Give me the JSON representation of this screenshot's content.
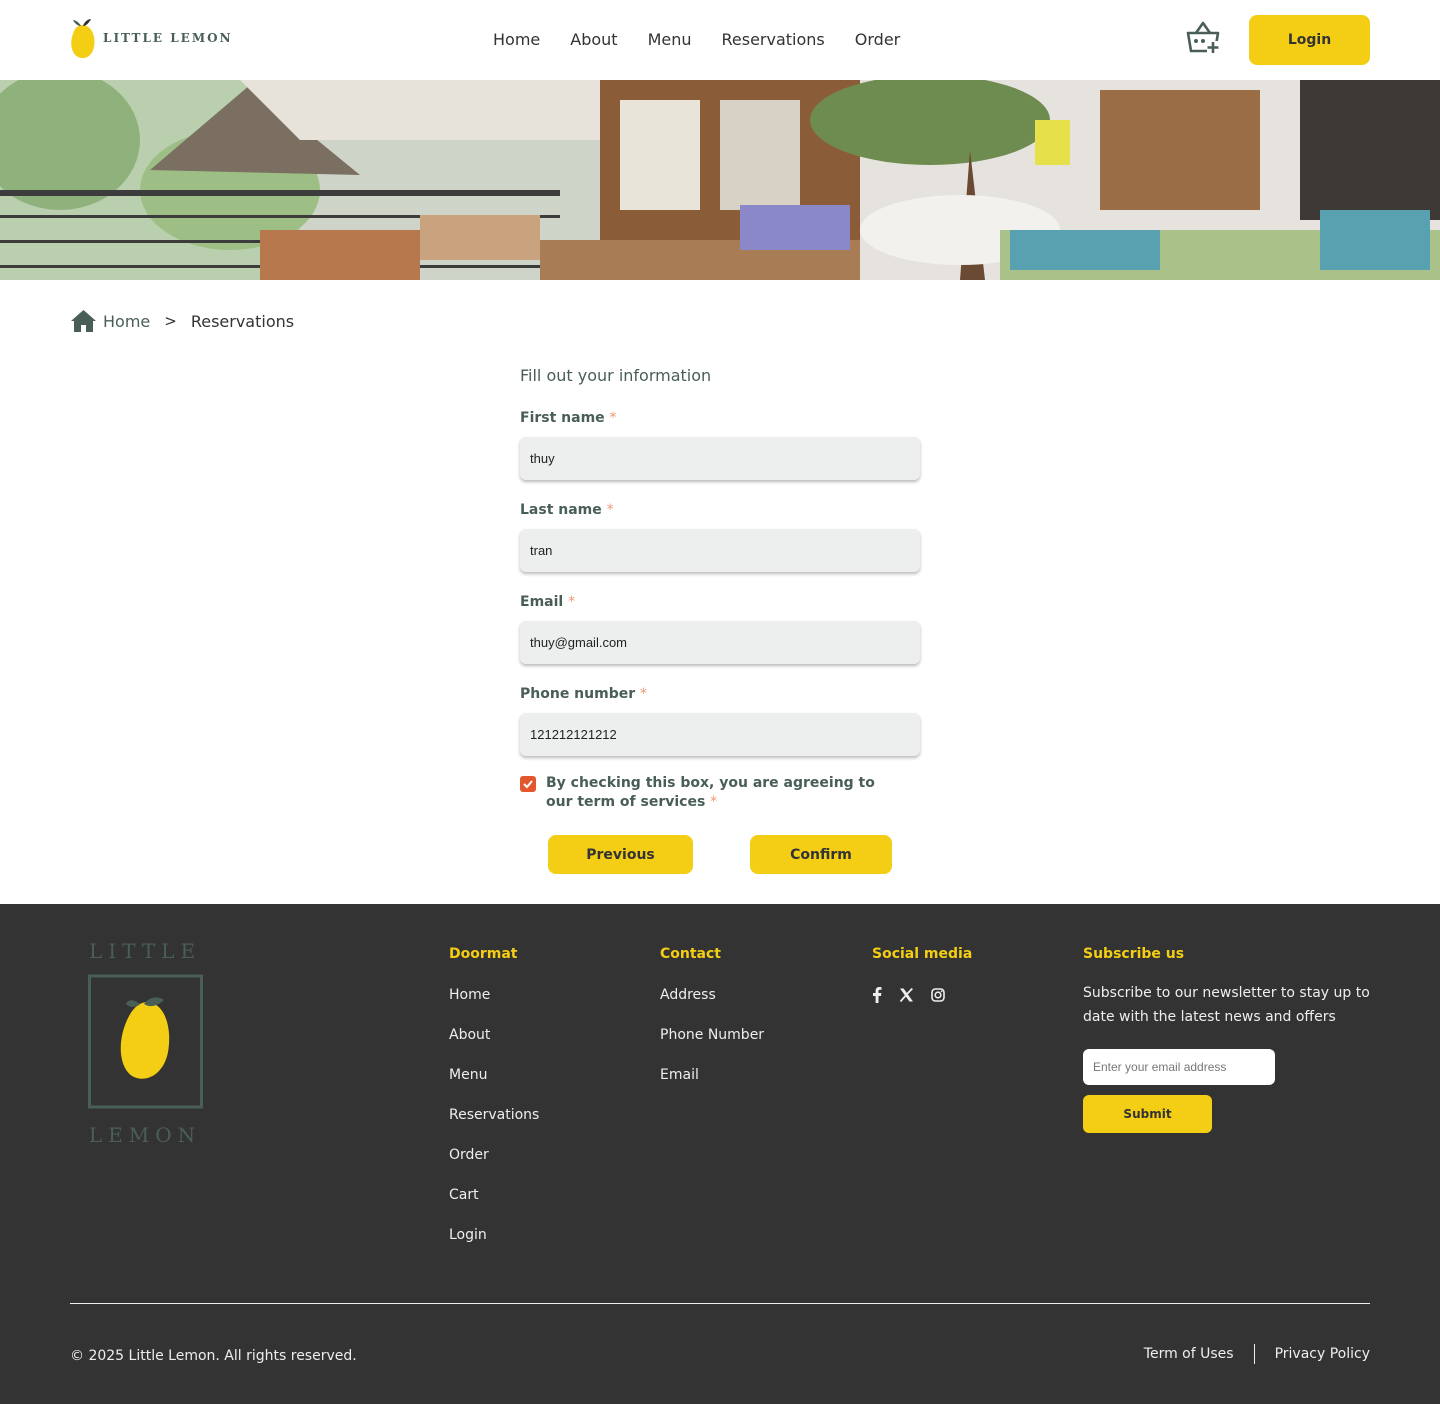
{
  "header": {
    "logo_text": "LITTLE LEMON",
    "nav": [
      "Home",
      "About",
      "Menu",
      "Reservations",
      "Order"
    ],
    "login_label": "Login"
  },
  "breadcrumb": {
    "home": "Home",
    "separator": ">",
    "current": "Reservations"
  },
  "form": {
    "title": "Fill out your information",
    "required_mark": "*",
    "first_name": {
      "label": "First name",
      "value": "thuy"
    },
    "last_name": {
      "label": "Last name",
      "value": "tran"
    },
    "email": {
      "label": "Email",
      "value": "thuy@gmail.com"
    },
    "phone": {
      "label": "Phone number",
      "value": "121212121212"
    },
    "agree_text": "By checking this box, you are agreeing to our term of services",
    "agree_checked": true,
    "previous_label": "Previous",
    "confirm_label": "Confirm"
  },
  "footer": {
    "logo_top": "LITTLE",
    "logo_bottom": "LEMON",
    "doormat": {
      "title": "Doormat",
      "links": [
        "Home",
        "About",
        "Menu",
        "Reservations",
        "Order",
        "Cart",
        "Login"
      ]
    },
    "contact": {
      "title": "Contact",
      "links": [
        "Address",
        "Phone Number",
        "Email"
      ]
    },
    "social": {
      "title": "Social media",
      "icons": [
        "facebook-icon",
        "x-icon",
        "instagram-icon"
      ]
    },
    "subscribe": {
      "title": "Subscribe us",
      "text": "Subscribe to our newsletter to stay up to date with the latest news and offers",
      "placeholder": "Enter your email address",
      "button_label": "Submit"
    },
    "copyright": "© 2025 Little Lemon. All rights reserved.",
    "terms": "Term of Uses",
    "privacy": "Privacy Policy"
  },
  "colors": {
    "brand_yellow": "#f4ce14",
    "brand_green": "#495e57",
    "footer_bg": "#333333",
    "required": "#ee9972",
    "checkbox": "#e4572e"
  }
}
